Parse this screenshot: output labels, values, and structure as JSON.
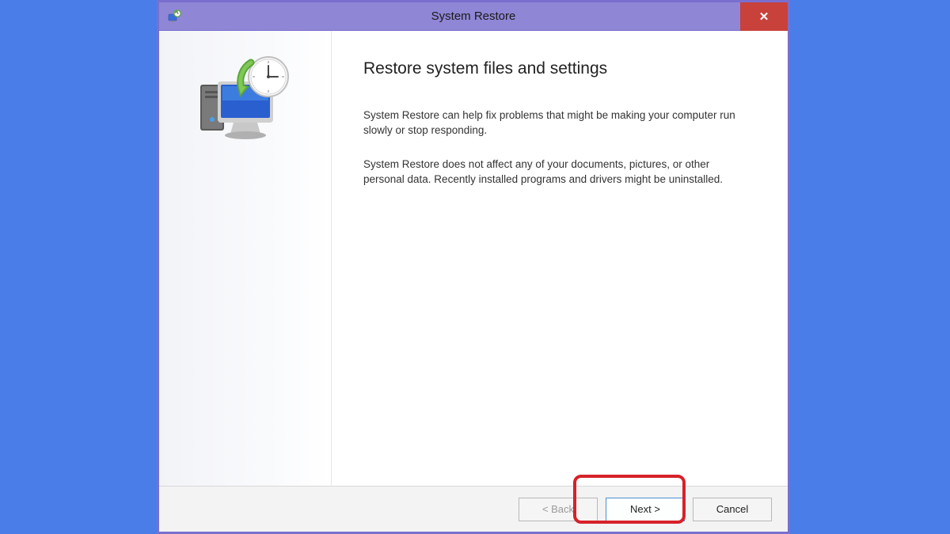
{
  "titlebar": {
    "title": "System Restore",
    "close_label": "✕"
  },
  "main": {
    "heading": "Restore system files and settings",
    "para1": "System Restore can help fix problems that might be making your computer run slowly or stop responding.",
    "para2": "System Restore does not affect any of your documents, pictures, or other personal data. Recently installed programs and drivers might be uninstalled."
  },
  "buttons": {
    "back": "< Back",
    "next": "Next >",
    "cancel": "Cancel"
  },
  "icons": {
    "titlebar": "system-restore-icon",
    "graphic": "restore-clock-monitor-icon"
  }
}
